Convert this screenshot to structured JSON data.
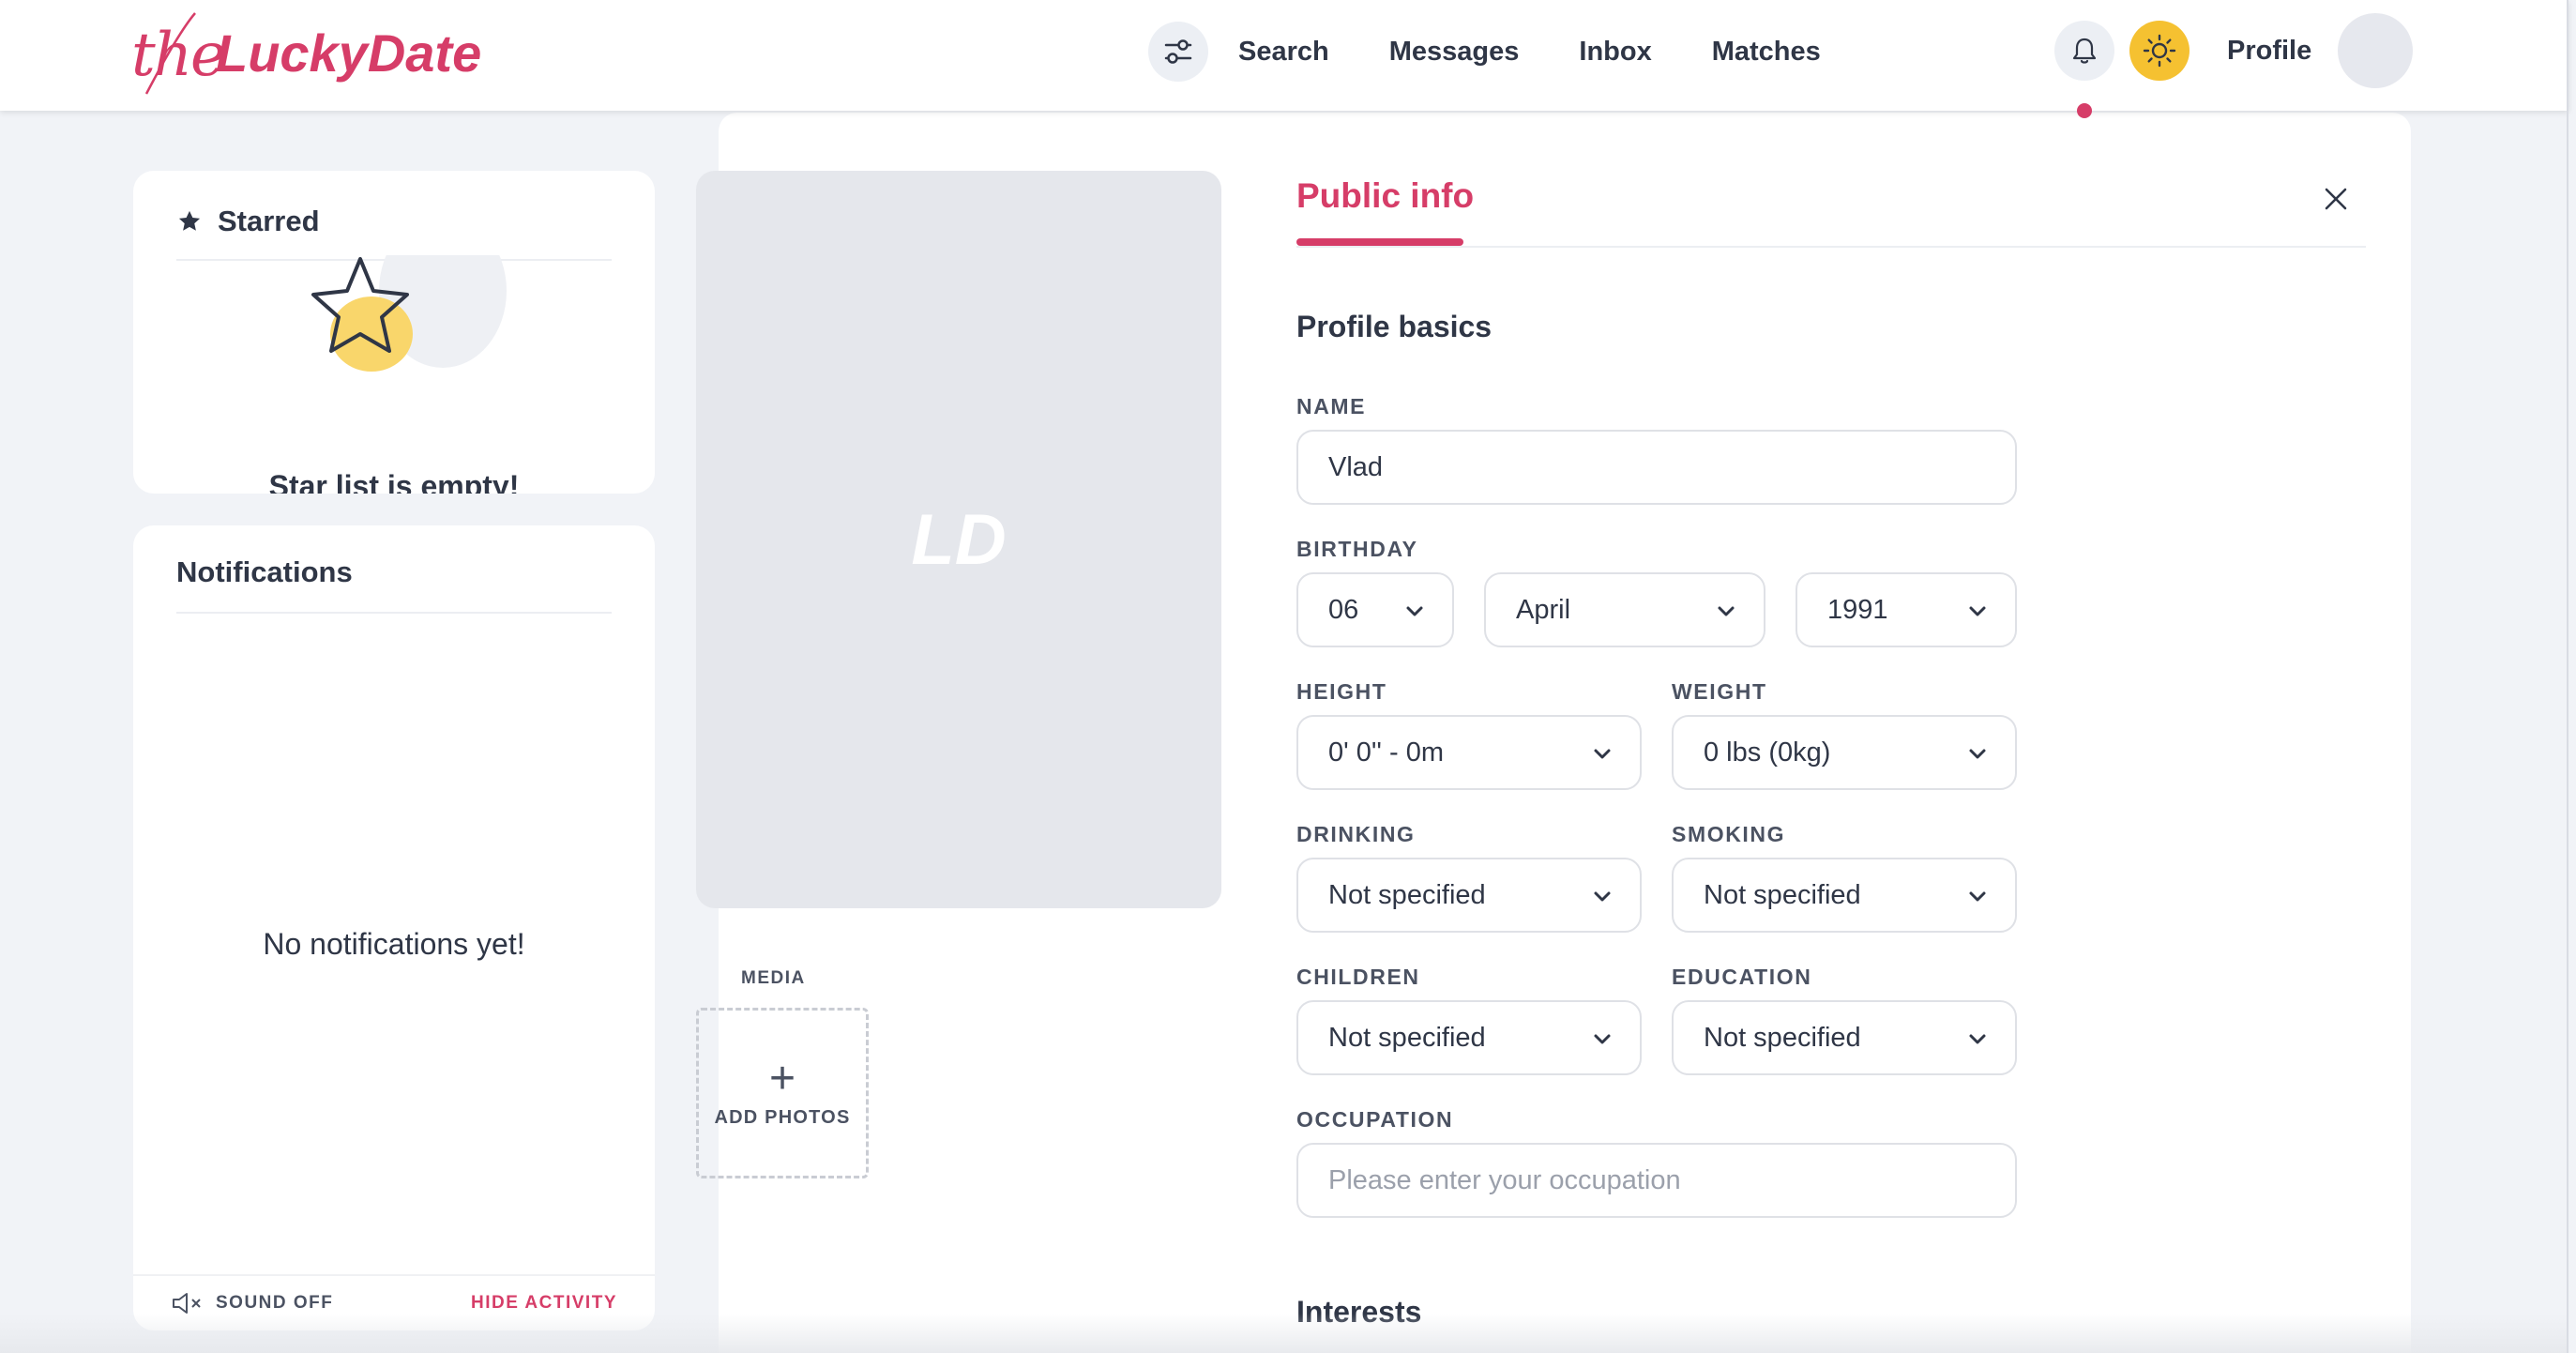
{
  "brand": {
    "prefix": "the",
    "name": "LuckyDate",
    "accent_color": "#d63d68",
    "theme_color": "#f5c131"
  },
  "header": {
    "filter_icon": "filter-sliders-icon",
    "nav": [
      "Search",
      "Messages",
      "Inbox",
      "Matches"
    ],
    "notification_icon": "bell-icon",
    "theme_icon": "sun-icon",
    "profile_label": "Profile"
  },
  "sidebar": {
    "starred": {
      "icon": "star-icon",
      "title": "Starred",
      "empty_text": "Star list is empty!"
    },
    "notifications": {
      "title": "Notifications",
      "empty_text": "No notifications yet!",
      "sound_icon": "speaker-muted-icon",
      "sound_label": "SOUND OFF",
      "hide_activity_label": "HIDE ACTIVITY"
    }
  },
  "profile": {
    "photo_initials": "LD",
    "media_label": "MEDIA",
    "add_photos_label": "ADD PHOTOS",
    "tab_label": "Public info",
    "basics_title": "Profile basics",
    "fields": {
      "name": {
        "label": "NAME",
        "value": "Vlad"
      },
      "birthday": {
        "label": "BIRTHDAY",
        "day": "06",
        "month": "April",
        "year": "1991"
      },
      "height": {
        "label": "HEIGHT",
        "value": "0' 0'' - 0m"
      },
      "weight": {
        "label": "WEIGHT",
        "value": "0 lbs (0kg)"
      },
      "drinking": {
        "label": "DRINKING",
        "value": "Not specified"
      },
      "smoking": {
        "label": "SMOKING",
        "value": "Not specified"
      },
      "children": {
        "label": "CHILDREN",
        "value": "Not specified"
      },
      "education": {
        "label": "EDUCATION",
        "value": "Not specified"
      },
      "occupation": {
        "label": "OCCUPATION",
        "placeholder": "Please enter your occupation"
      }
    },
    "interests_title": "Interests"
  }
}
